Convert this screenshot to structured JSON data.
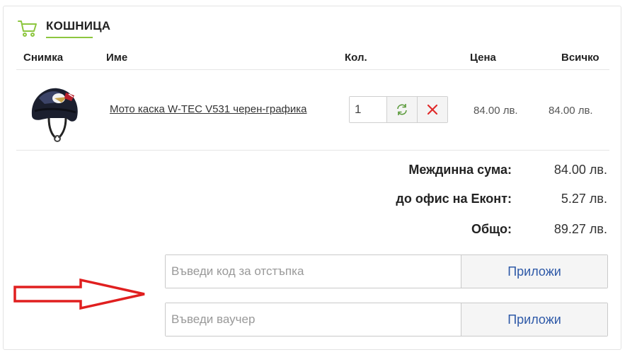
{
  "cart": {
    "title": "КОШНИЦА",
    "columns": {
      "image": "Снимка",
      "name": "Име",
      "qty": "Кол.",
      "price": "Цена",
      "total": "Всичко"
    },
    "items": [
      {
        "name": "Мото каска W-TEC V531 черен-графика",
        "quantity": "1",
        "price": "84.00 лв.",
        "total": "84.00 лв."
      }
    ],
    "summary": [
      {
        "label": "Междинна сума:",
        "value": "84.00 лв."
      },
      {
        "label": "до офис на Еконт:",
        "value": "5.27 лв."
      },
      {
        "label": "Общо:",
        "value": "89.27 лв."
      }
    ],
    "discount": {
      "placeholder": "Въведи код за отстъпка",
      "button": "Приложи"
    },
    "voucher": {
      "placeholder": "Въведи ваучер",
      "button": "Приложи"
    }
  },
  "icons": {
    "cart": "shopping-cart-icon",
    "refresh": "refresh-icon",
    "remove": "close-icon"
  },
  "colors": {
    "accent": "#8dc63f",
    "remove": "#e02b2b",
    "refresh": "#5a9a3a",
    "button_text": "#2f5aa8",
    "arrow": "#e01f1f"
  }
}
